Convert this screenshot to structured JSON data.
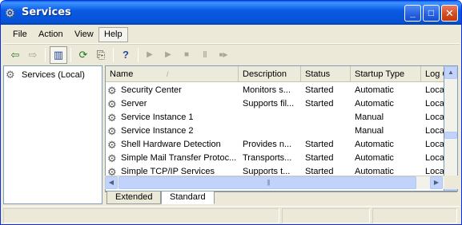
{
  "window": {
    "title": "Services",
    "icon": "services-gear-icon",
    "controls": {
      "minimize": "_",
      "maximize": "□",
      "close": "✕"
    }
  },
  "menu": {
    "file": "File",
    "action": "Action",
    "view": "View",
    "help": "Help"
  },
  "toolbar": {
    "back": "⇦",
    "forward": "⇨",
    "show_hide_tree": "▥",
    "refresh": "⟳",
    "export_list": "⎘",
    "help": "?",
    "start": "▶",
    "start2": "▶",
    "stop": "■",
    "pause": "‖",
    "restart": "■▶"
  },
  "tree": {
    "root_label": "Services (Local)"
  },
  "list": {
    "columns": [
      "Name",
      "Description",
      "Status",
      "Startup Type",
      "Log O"
    ],
    "sort_indicator": "/",
    "rows": [
      {
        "name": "Security Center",
        "description": "Monitors s...",
        "status": "Started",
        "startup": "Automatic",
        "logon": "Local"
      },
      {
        "name": "Server",
        "description": "Supports fil...",
        "status": "Started",
        "startup": "Automatic",
        "logon": "Local"
      },
      {
        "name": "Service Instance 1",
        "description": "",
        "status": "",
        "startup": "Manual",
        "logon": "Local"
      },
      {
        "name": "Service Instance 2",
        "description": "",
        "status": "",
        "startup": "Manual",
        "logon": "Local"
      },
      {
        "name": "Shell Hardware Detection",
        "description": "Provides n...",
        "status": "Started",
        "startup": "Automatic",
        "logon": "Local"
      },
      {
        "name": "Simple Mail Transfer Protoc...",
        "description": "Transports...",
        "status": "Started",
        "startup": "Automatic",
        "logon": "Local"
      },
      {
        "name": "Simple TCP/IP Services",
        "description": "Supports t...",
        "status": "Started",
        "startup": "Automatic",
        "logon": "Local"
      }
    ]
  },
  "tabs": {
    "extended": "Extended",
    "standard": "Standard"
  },
  "colors": {
    "title_bar": "#0753d6",
    "window_bg": "#ece9d8",
    "border": "#7f9db9",
    "close_button": "#d3491e"
  }
}
